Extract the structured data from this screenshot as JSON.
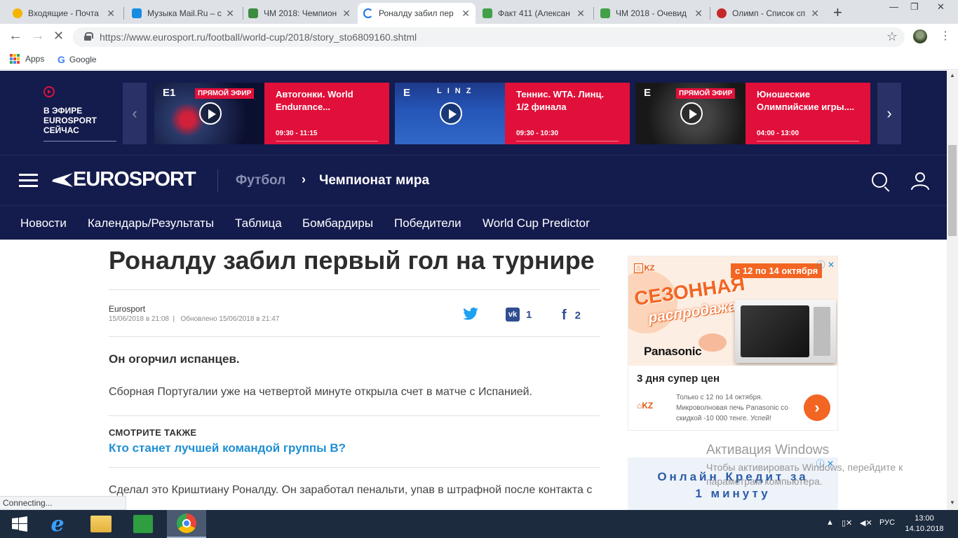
{
  "browser": {
    "tabs": [
      {
        "title": "Входящие - Почта",
        "color": "#f4b400",
        "active": false
      },
      {
        "title": "Музыка Mail.Ru – с",
        "color": "#168de2",
        "active": false
      },
      {
        "title": "ЧМ 2018: Чемпион",
        "color": "#3c8c40",
        "active": false
      },
      {
        "title": "Роналду забил пер",
        "color": "#1a73e8",
        "active": true
      },
      {
        "title": "Факт 411 (Алексан",
        "color": "#43a047",
        "active": false
      },
      {
        "title": "ЧМ 2018 - Очевид",
        "color": "#43a047",
        "active": false
      },
      {
        "title": "Олимп - Список сп",
        "color": "#c62828",
        "active": false
      }
    ],
    "new_tab_label": "+",
    "url": "https://www.eurosport.ru/football/world-cup/2018/story_sto6809160.shtml",
    "bookmarks": [
      {
        "label": "Apps",
        "icon": "apps-grid-icon"
      },
      {
        "label": "Google",
        "icon": "google-icon"
      }
    ],
    "status_text": "Connecting..."
  },
  "live": {
    "label": "В ЭФИРЕ EUROSPORT СЕЙЧАС",
    "cards": [
      {
        "channel": "E1",
        "badge": "ПРЯМОЙ ЭФИР",
        "title": "Автогонки. World Endurance...",
        "time": "09:30 - 11:15",
        "thumb": "car-race"
      },
      {
        "channel": "E",
        "badge": "",
        "title": "Теннис. WTA. Линц. 1/2 финала",
        "time": "09:30 - 10:30",
        "thumb": "tennis"
      },
      {
        "channel": "E",
        "badge": "ПРЯМОЙ ЭФИР",
        "title": "Юношеские Олимпийские игры....",
        "time": "04:00 - 13:00",
        "thumb": "olympic"
      }
    ]
  },
  "header": {
    "logo": "EUROSPORT",
    "breadcrumb_1": "Футбол",
    "breadcrumb_2": "Чемпионат мира"
  },
  "subnav": [
    "Новости",
    "Календарь/Результаты",
    "Таблица",
    "Бомбардиры",
    "Победители",
    "World Cup Predictor"
  ],
  "article": {
    "title": "Роналду забил первый гол на турнире",
    "author": "Eurosport",
    "published": "15/06/2018 в 21:08",
    "updated": "Обновлено 15/06/2018 в 21:47",
    "share": {
      "vk_count": "1",
      "fb_count": "2"
    },
    "lead": "Он огорчил испанцев.",
    "paragraph_1": "Сборная Португалии уже на четвертой минуте открыла счет в матче с Испанией.",
    "see_also_label": "СМОТРИТЕ ТАКЖЕ",
    "see_also_link": "Кто станет лучшей командой группы B?",
    "paragraph_2": "Сделал это Криштиану Роналду. Он заработал пенальти, упав в штрафной после контакта с"
  },
  "ad1": {
    "brand_small": "KZ",
    "date_badge": "с 12 по 14 октября",
    "headline_1": "СЕЗОННАЯ",
    "headline_2": "распродажа",
    "panasonic": "Panasonic",
    "offer_title": "3 дня супер цен",
    "offer_copy": "Только с 12 по 14 октября. Микроволновая печь Panasonic со скидкой -10 000 тенге. Успей!",
    "go": "›"
  },
  "ad2": {
    "line_1": "Онлайн Кредит за",
    "line_2": "1 минуту"
  },
  "watermark": {
    "title": "Активация Windows",
    "text": "Чтобы активировать Windows, перейдите к параметрам компьютера."
  },
  "taskbar": {
    "lang": "РУС",
    "time": "13:00",
    "date": "14.10.2018"
  }
}
